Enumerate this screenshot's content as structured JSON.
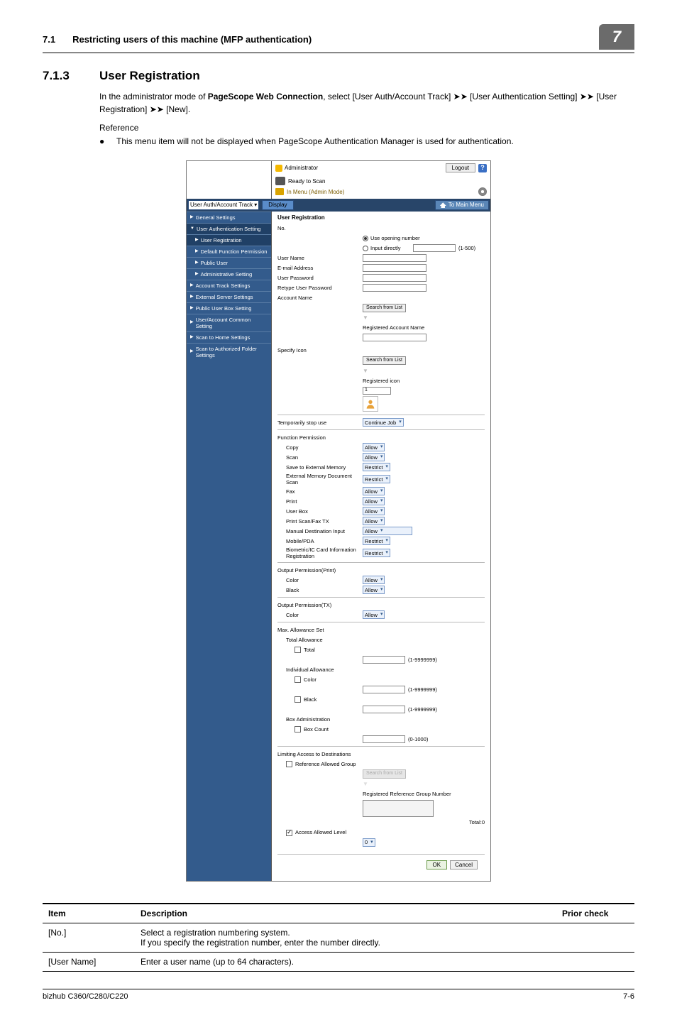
{
  "header": {
    "section": "7.1",
    "title": "Restricting users of this machine (MFP authentication)",
    "chapter": "7"
  },
  "heading": {
    "num": "7.1.3",
    "text": "User Registration"
  },
  "intro": {
    "p1a": "In the administrator mode of ",
    "p1b": "PageScope Web Connection",
    "p1c": ", select [User Auth/Account Track] ",
    "p1d": " [User Authentication Setting] ",
    "p1e": " [User Registration] ",
    "p1f": " [New].",
    "ref": "Reference",
    "bul1a": "This menu item will not be displayed when ",
    "bul1b": "PageScope Authentication Manager",
    "bul1c": " is used for authentication."
  },
  "shot": {
    "admin": "Administrator",
    "logout": "Logout",
    "ready": "Ready to Scan",
    "menu": "In Menu (Admin Mode)",
    "dropdown": "User Auth/Account Track",
    "display": "Display",
    "tomain": "To Main Menu",
    "sidebar": [
      "General Settings",
      "User Authentication Setting",
      "User Registration",
      "Default Function Permission",
      "Public User",
      "Administrative Setting",
      "Account Track Settings",
      "External Server Settings",
      "Public User Box Setting",
      "User/Account Common Setting",
      "Scan to Home Settings",
      "Scan to Authorized Folder Settings"
    ],
    "content": {
      "title": "User Registration",
      "no": "No.",
      "opt1": "Use opening number",
      "opt2": "Input directly",
      "range_no": "(1-500)",
      "uname": "User Name",
      "email": "E-mail Address",
      "upass": "User Password",
      "rpass": "Retype User Password",
      "acct": "Account Name",
      "search": "Search from List",
      "reg_acct": "Registered Account Name",
      "spec_icon": "Specify Icon",
      "reg_icon": "Registered icon",
      "reg_icon_val": "1",
      "temp_stop": "Temporarily stop use",
      "temp_stop_val": "Continue Job",
      "func_perm": "Function Permission",
      "fp": {
        "copy": {
          "l": "Copy",
          "v": "Allow"
        },
        "scan": {
          "l": "Scan",
          "v": "Allow"
        },
        "save_ext": {
          "l": "Save to External Memory",
          "v": "Restrict"
        },
        "ext_scan": {
          "l": "External Memory Document Scan",
          "v": "Restrict"
        },
        "fax": {
          "l": "Fax",
          "v": "Allow"
        },
        "print": {
          "l": "Print",
          "v": "Allow"
        },
        "ubox": {
          "l": "User Box",
          "v": "Allow"
        },
        "psfax": {
          "l": "Print Scan/Fax TX",
          "v": "Allow"
        },
        "mdest": {
          "l": "Manual Destination Input",
          "v": "Allow"
        },
        "mobile": {
          "l": "Mobile/PDA",
          "v": "Restrict"
        },
        "bio": {
          "l": "Biometric/IC Card Information Registration",
          "v": "Restrict"
        }
      },
      "out_print": "Output Permission(Print)",
      "op_color": {
        "l": "Color",
        "v": "Allow"
      },
      "op_black": {
        "l": "Black",
        "v": "Allow"
      },
      "out_tx": "Output Permission(TX)",
      "otx_color": {
        "l": "Color",
        "v": "Allow"
      },
      "max_set": "Max. Allowance Set",
      "total_allow": "Total Allowance",
      "total": "Total",
      "range_big": "(1-9999999)",
      "indiv": "Individual Allowance",
      "color": "Color",
      "black": "Black",
      "boxadm": "Box Administration",
      "boxcount": "Box Count",
      "range_box": "(0-1000)",
      "limit": "Limiting Access to Destinations",
      "refgrp": "Reference Allowed Group",
      "reg_ref": "Registered Reference Group Number",
      "total0": "Total:0",
      "access_lvl": "Access Allowed Level",
      "access_val": "0",
      "ok": "OK",
      "cancel": "Cancel"
    }
  },
  "table": {
    "h1": "Item",
    "h2": "Description",
    "h3": "Prior check",
    "rows": [
      {
        "c1": "[No.]",
        "c2": "Select a registration numbering system.\nIf you specify the registration number, enter the number directly."
      },
      {
        "c1": "[User Name]",
        "c2": "Enter a user name (up to 64 characters)."
      }
    ]
  },
  "footer": {
    "model": "bizhub C360/C280/C220",
    "page": "7-6"
  }
}
